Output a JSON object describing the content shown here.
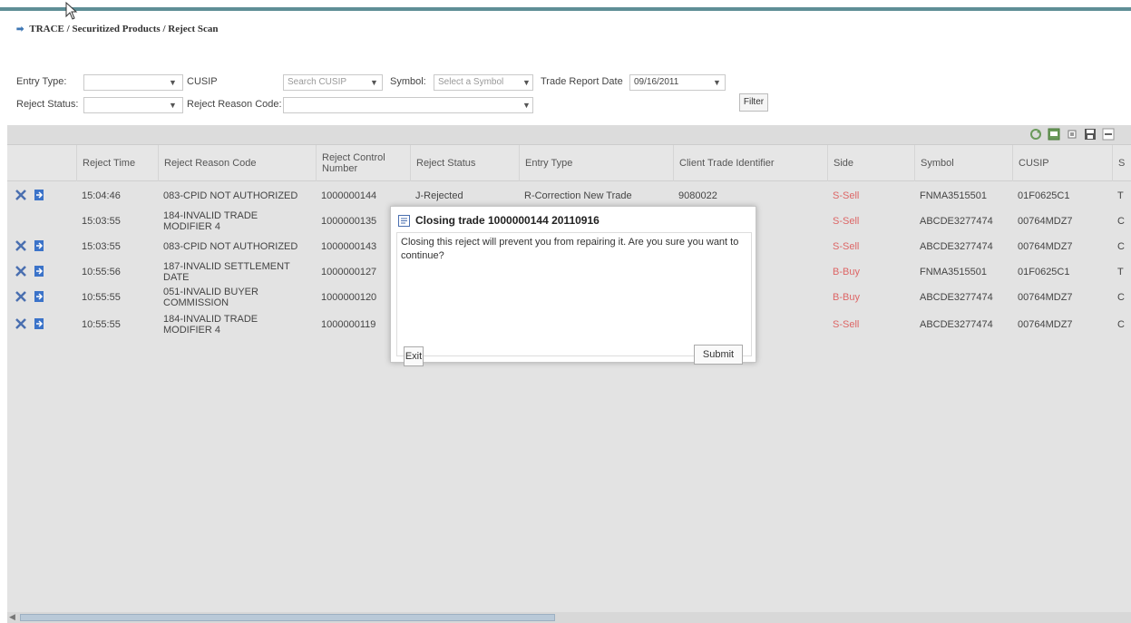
{
  "breadcrumb": "TRACE / Securitized Products / Reject Scan",
  "filters": {
    "entry_type_label": "Entry Type:",
    "entry_type_value": "",
    "cusip_label": "CUSIP",
    "cusip_placeholder": "Search CUSIP",
    "symbol_label": "Symbol:",
    "symbol_placeholder": "Select a Symbol",
    "trade_report_date_label": "Trade Report Date",
    "trade_report_date_value": "09/16/2011",
    "reject_status_label": "Reject Status:",
    "reject_status_value": "",
    "reject_reason_code_label": "Reject Reason Code:",
    "reject_reason_code_value": "",
    "filter_button": "Filter"
  },
  "columns": [
    "Reject Time",
    "Reject Reason Code",
    "Reject Control Number",
    "Reject Status",
    "Entry Type",
    "Client Trade Identifier",
    "Side",
    "Symbol",
    "CUSIP",
    "S"
  ],
  "rows": [
    {
      "time": "15:04:46",
      "reason": "083-CPID NOT AUTHORIZED",
      "control": "1000000144",
      "status": "J-Rejected",
      "entry": "R-Correction New Trade",
      "client_id": "9080022",
      "side": "S-Sell",
      "symbol": "FNMA3515501",
      "cusip": "01F0625C1",
      "s": "T",
      "actions": true
    },
    {
      "time": "15:03:55",
      "reason": "184-INVALID TRADE MODIFIER 4",
      "control": "1000000135",
      "status": "",
      "entry": "",
      "client_id": "",
      "side": "S-Sell",
      "symbol": "ABCDE3277474",
      "cusip": "00764MDZ7",
      "s": "C",
      "actions": false
    },
    {
      "time": "15:03:55",
      "reason": "083-CPID NOT AUTHORIZED",
      "control": "1000000143",
      "status": "",
      "entry": "",
      "client_id": "",
      "side": "S-Sell",
      "symbol": "ABCDE3277474",
      "cusip": "00764MDZ7",
      "s": "C",
      "actions": true
    },
    {
      "time": "10:55:56",
      "reason": "187-INVALID SETTLEMENT DATE",
      "control": "1000000127",
      "status": "",
      "entry": "",
      "client_id": "",
      "side": "B-Buy",
      "symbol": "FNMA3515501",
      "cusip": "01F0625C1",
      "s": "T",
      "actions": true
    },
    {
      "time": "10:55:55",
      "reason": "051-INVALID BUYER COMMISSION",
      "control": "1000000120",
      "status": "",
      "entry": "",
      "client_id": "",
      "side": "B-Buy",
      "symbol": "ABCDE3277474",
      "cusip": "00764MDZ7",
      "s": "C",
      "actions": true
    },
    {
      "time": "10:55:55",
      "reason": "184-INVALID TRADE MODIFIER 4",
      "control": "1000000119",
      "status": "",
      "entry": "",
      "client_id": "",
      "side": "S-Sell",
      "symbol": "ABCDE3277474",
      "cusip": "00764MDZ7",
      "s": "C",
      "actions": true
    }
  ],
  "dialog": {
    "title": "Closing trade 1000000144 20110916",
    "message": "Closing this reject will prevent you from repairing it. Are you sure you want to continue?",
    "exit_label": "Exit",
    "submit_label": "Submit"
  },
  "colors": {
    "accent": "#5f8e96",
    "sell": "#d66666",
    "grid_bg": "#e3e3e3"
  }
}
